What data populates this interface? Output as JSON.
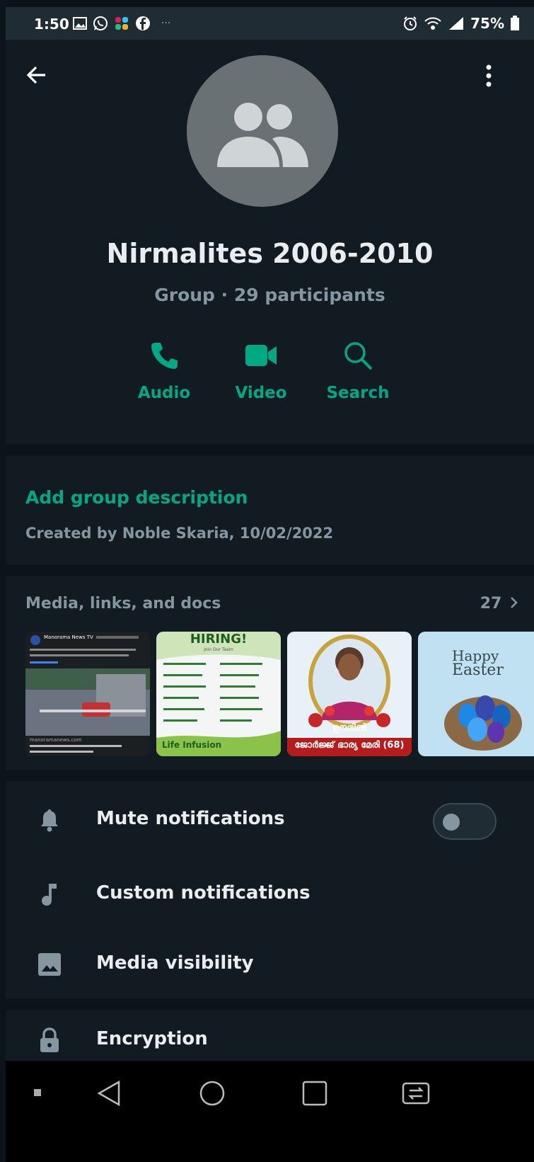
{
  "status_bar": {
    "time": "1:50",
    "overflow": "···",
    "battery": "75%"
  },
  "group": {
    "name": "Nirmalites 2006-2010",
    "subtitle": "Group · 29 participants"
  },
  "actions": [
    {
      "label": "Audio",
      "icon": "phone-icon"
    },
    {
      "label": "Video",
      "icon": "video-icon"
    },
    {
      "label": "Search",
      "icon": "search-icon"
    }
  ],
  "description": {
    "add_label": "Add group description",
    "created": "Created by Noble Skaria, 10/02/2022"
  },
  "media": {
    "title": "Media, links, and docs",
    "count": "27",
    "thumbs": [
      {
        "kind": "news",
        "header": "Manorama News TV",
        "caption": "manoramanews.com"
      },
      {
        "kind": "hiring",
        "header": "HIRING!",
        "sub": "Join Our Team",
        "brand": "Life Infusion"
      },
      {
        "kind": "obituary",
        "caption": "ഊരിൽ",
        "name": "ജോർജ്ജ് ഭാര്യ മേരി (68)"
      },
      {
        "kind": "easter",
        "line1": "Happy",
        "line2": "Easter"
      }
    ]
  },
  "settings": [
    {
      "label": "Mute notifications",
      "icon": "bell-icon",
      "toggle": false
    },
    {
      "label": "Custom notifications",
      "icon": "music-note-icon"
    },
    {
      "label": "Media visibility",
      "icon": "image-icon"
    },
    {
      "label": "Encryption",
      "icon": "lock-icon"
    }
  ],
  "colors": {
    "accent": "#00a884",
    "background": "#111b21",
    "secondary_text": "#8696a0"
  }
}
